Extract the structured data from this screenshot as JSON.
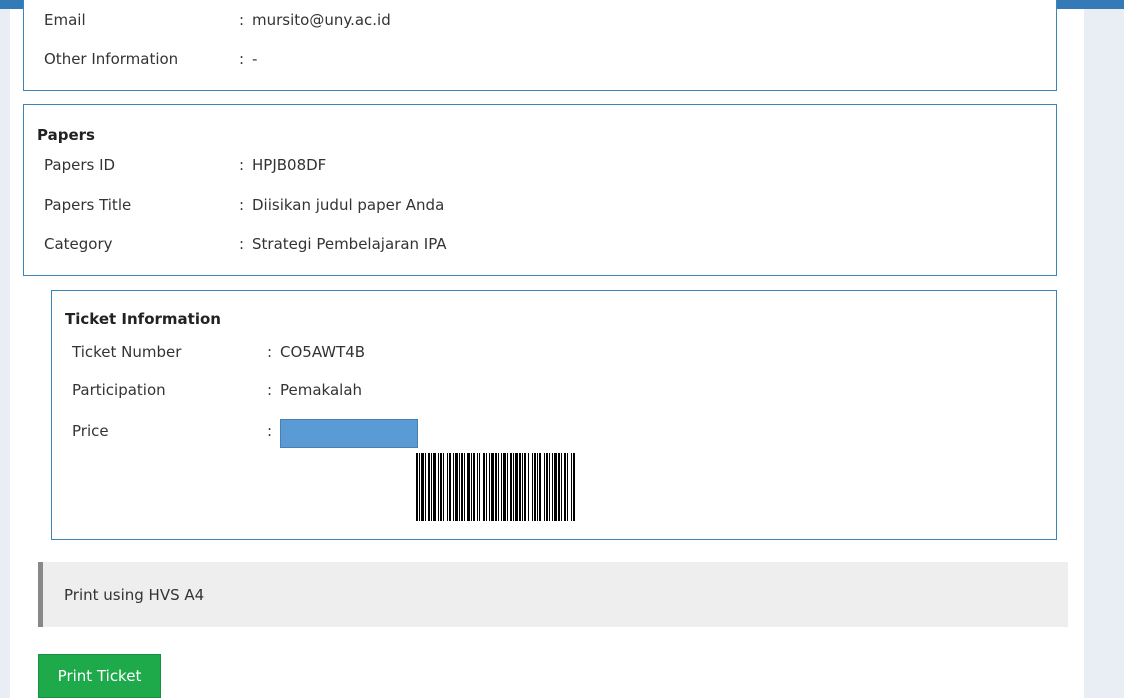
{
  "participant": {
    "rows": [
      {
        "label": "Email",
        "value": "mursito@uny.ac.id"
      },
      {
        "label": "Other Information",
        "value": "-"
      }
    ]
  },
  "papers": {
    "title": "Papers",
    "rows": [
      {
        "label": "Papers ID",
        "value": "HPJB08DF"
      },
      {
        "label": "Papers Title",
        "value": "Diisikan judul paper Anda"
      },
      {
        "label": "Category",
        "value": "Strategi Pembelajaran IPA"
      }
    ]
  },
  "ticket": {
    "title": "Ticket Information",
    "rows": [
      {
        "label": "Ticket Number",
        "value": "CO5AWT4B"
      },
      {
        "label": "Participation",
        "value": "Pemakalah"
      },
      {
        "label": "Price",
        "value": ""
      }
    ]
  },
  "separator": ":",
  "note": "Print using HVS A4",
  "print_button": "Print Ticket",
  "colors": {
    "accent": "#337ab7",
    "button": "#1eaa4b",
    "masked": "#5b9bd5"
  }
}
